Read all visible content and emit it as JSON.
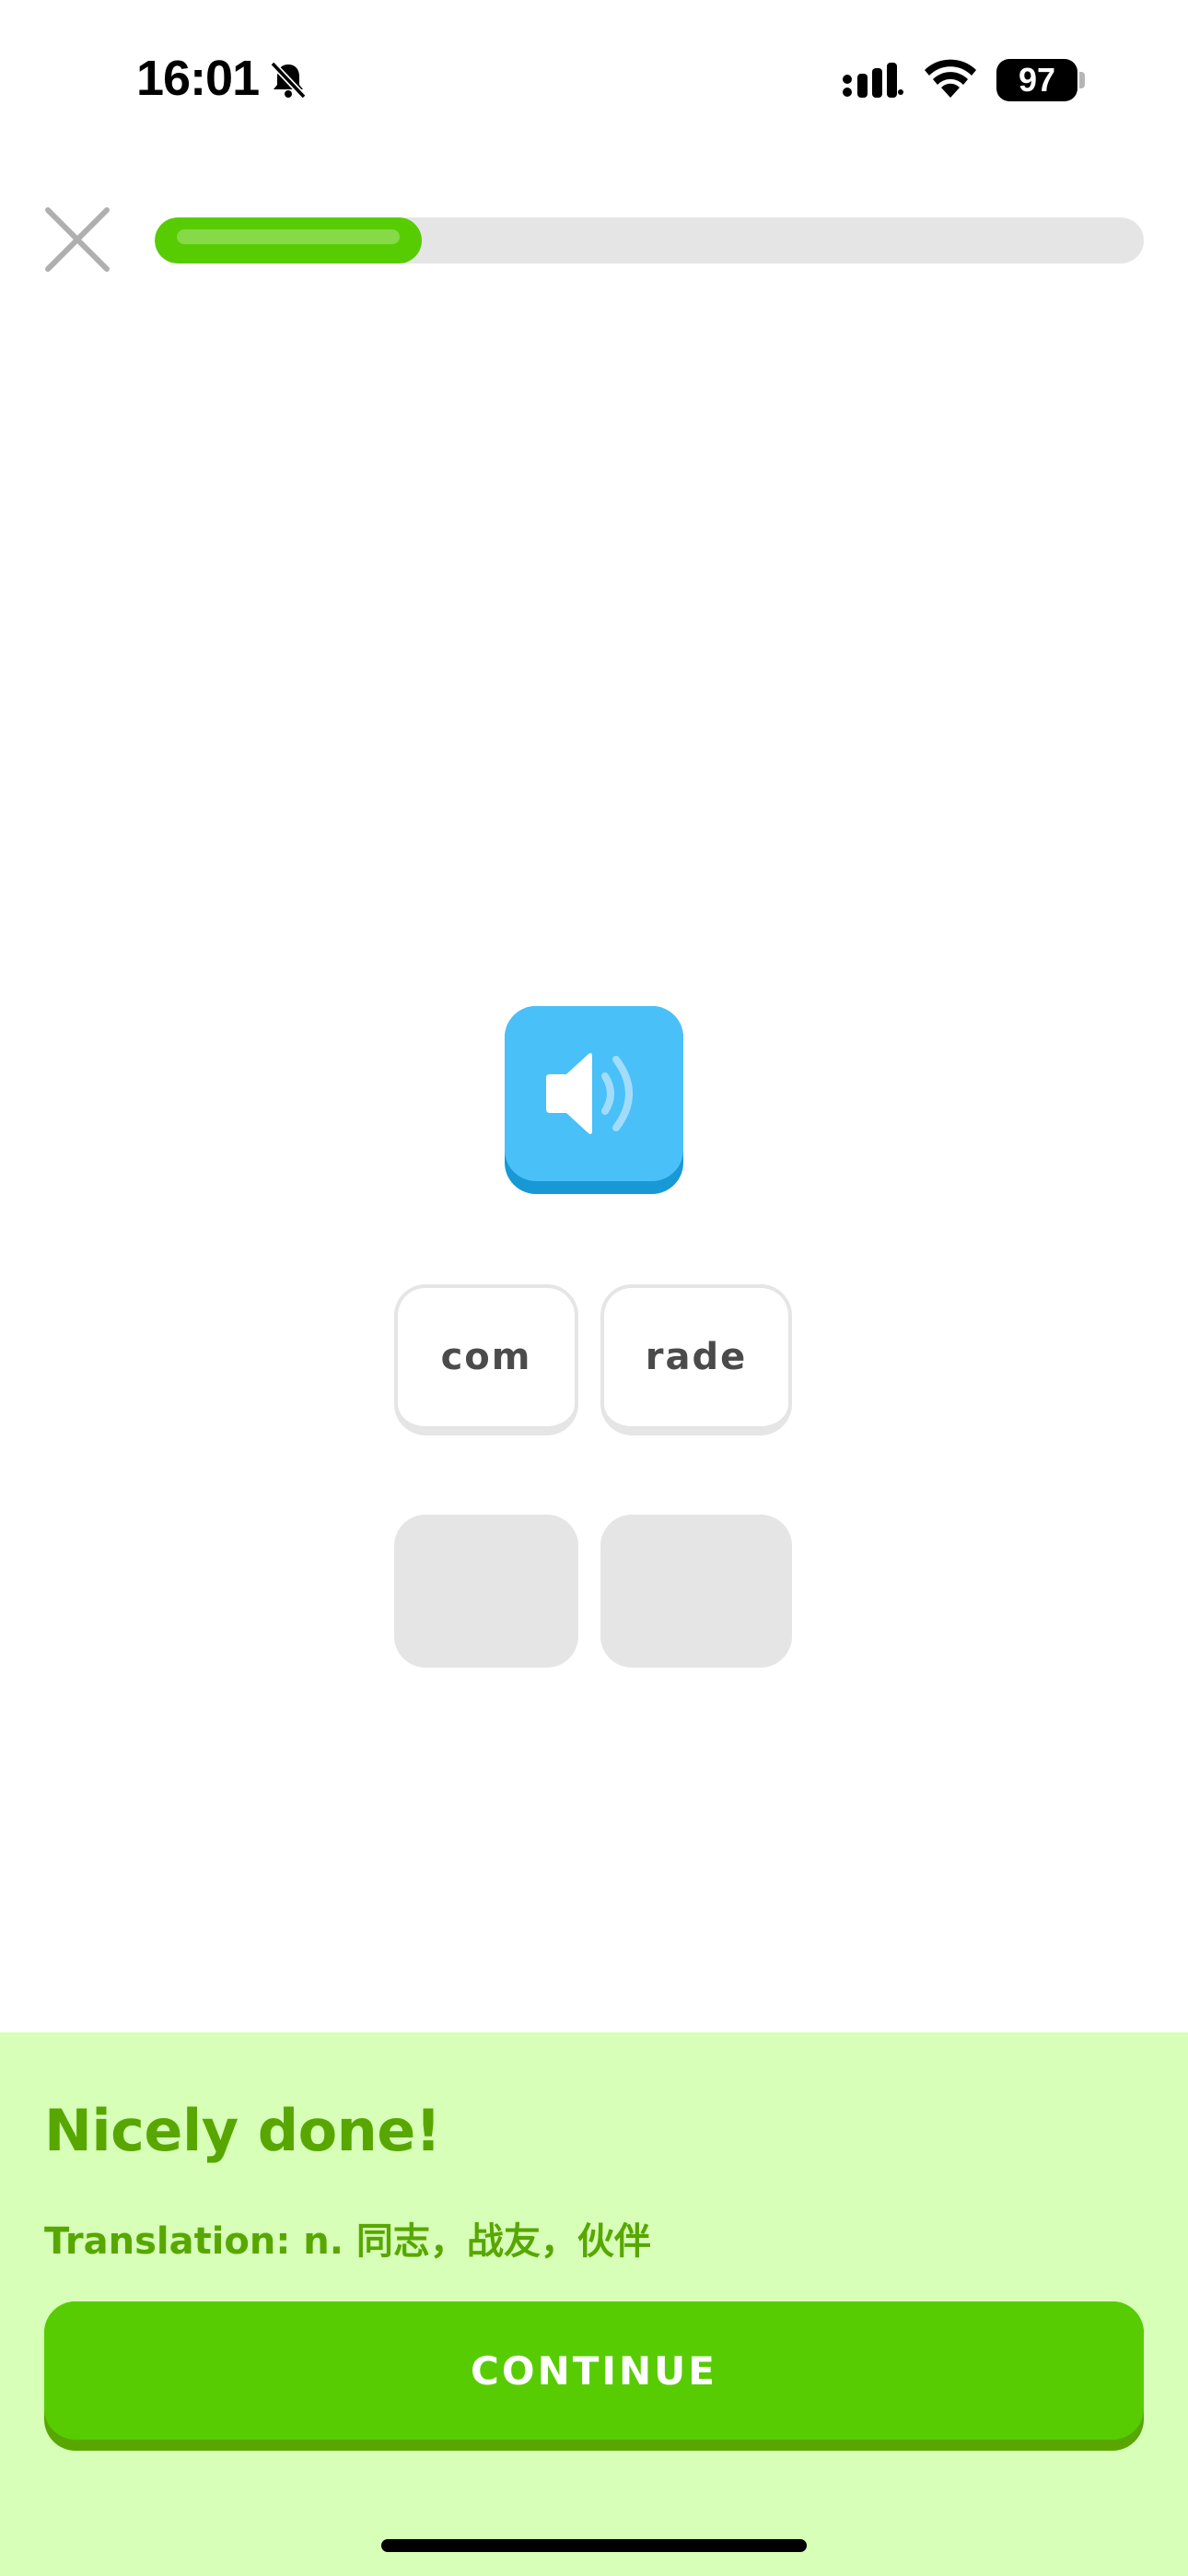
{
  "status_bar": {
    "time": "16:01",
    "battery": "97",
    "icons": [
      "bell-off-icon",
      "signal-icon",
      "wifi-icon",
      "battery-icon"
    ]
  },
  "lesson": {
    "progress_fraction": 0.27,
    "close_icon": "close-icon",
    "audio_icon": "speaker-icon"
  },
  "tiles": [
    {
      "label": "com"
    },
    {
      "label": "rade"
    }
  ],
  "answer_slots": 2,
  "feedback": {
    "title": "Nicely done!",
    "translation": "Translation: n. 同志，战友，伙伴",
    "continue_label": "CONTINUE"
  },
  "colors": {
    "primary_green": "#58cc02",
    "dark_green": "#58a700",
    "feedback_bg": "#d7ffb8",
    "audio_blue": "#49c0f8",
    "tile_border": "#e5e5e5"
  }
}
